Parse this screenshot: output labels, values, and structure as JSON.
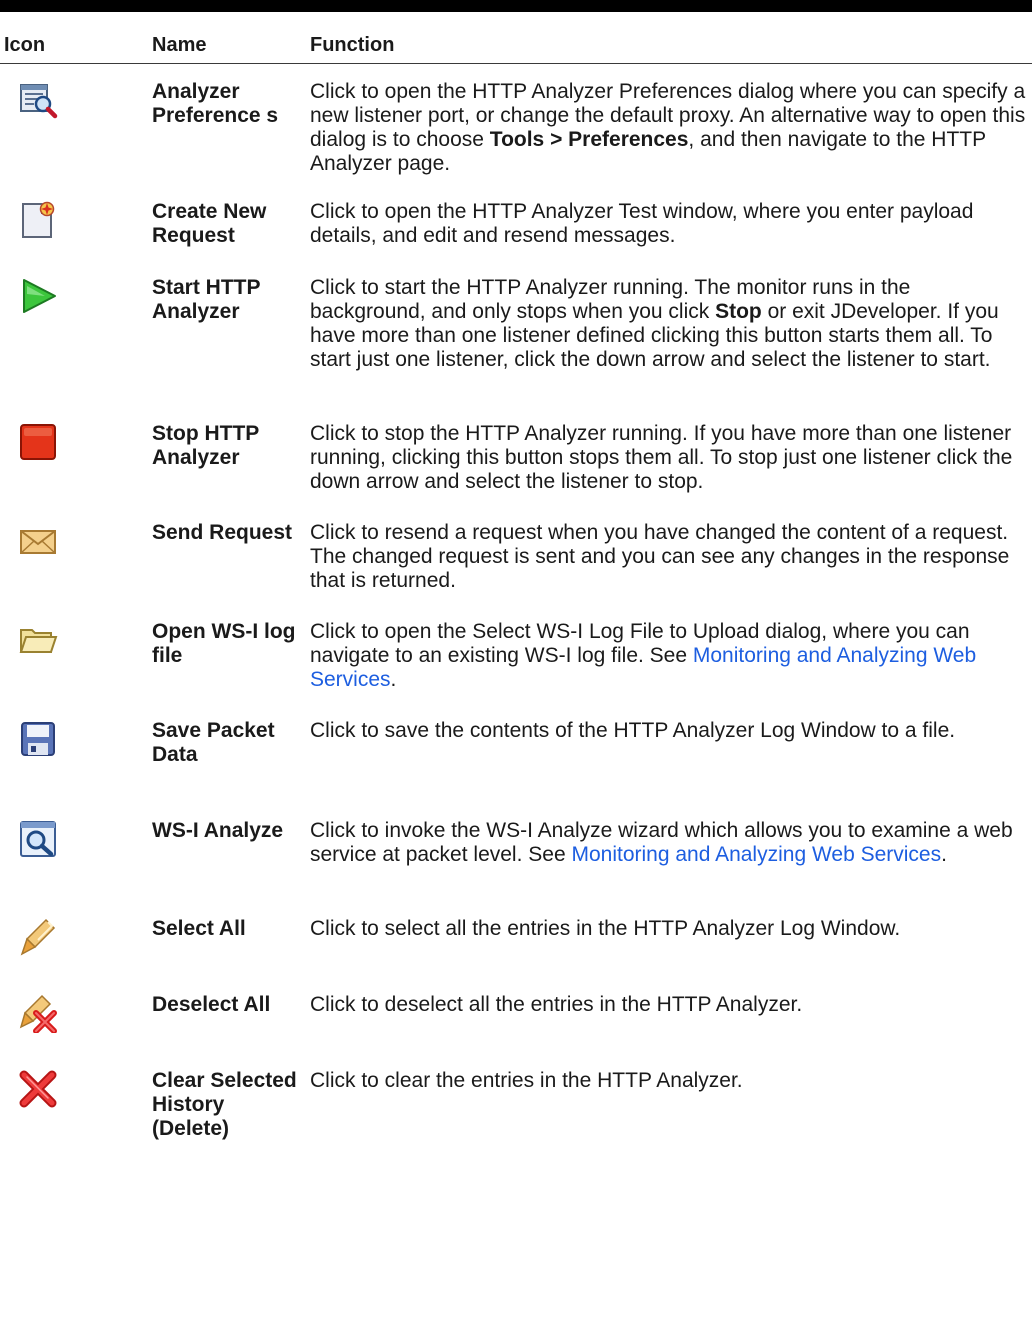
{
  "headers": {
    "icon": "Icon",
    "name": "Name",
    "function": "Function"
  },
  "rows": [
    {
      "icon": "analyzer-preferences-icon",
      "name": "Analyzer Preference s",
      "func": {
        "t1": "Click to open the HTTP Analyzer Preferences dialog where you can specify a new listener port, or change the default proxy. An alternative way to open this dialog is to choose ",
        "b1": "Tools > Preferences",
        "t2": ", and then navigate to the HTTP Analyzer page."
      }
    },
    {
      "icon": "create-new-request-icon",
      "name": "Create New Request",
      "func": {
        "t1": "Click to open the HTTP Analyzer Test window, where you enter payload details, and edit and resend messages."
      }
    },
    {
      "icon": "start-http-analyzer-icon",
      "name": "Start HTTP Analyzer",
      "func": {
        "t1": "Click to start the HTTP Analyzer running. The monitor runs in the background, and only stops when you click ",
        "b1": "Stop",
        "t2": " or exit JDeveloper. If you have more than one listener defined clicking this button starts them all. To start just one listener, click the down arrow and select the listener to start."
      }
    },
    {
      "icon": "stop-http-analyzer-icon",
      "name": "Stop HTTP Analyzer",
      "func": {
        "t1": "Click to stop the HTTP Analyzer running. If you have more than one listener running, clicking this button stops them all. To stop just one listener click the down arrow and select the listener to stop."
      }
    },
    {
      "icon": "send-request-icon",
      "name": "Send Request",
      "func": {
        "t1": "Click to resend a request when you have changed the content of a request. The changed request is sent and you can see any changes in the response that is returned."
      }
    },
    {
      "icon": "open-folder-icon",
      "name": "Open WS-I log file",
      "func": {
        "t1": "Click to open the Select WS-I Log File to Upload dialog, where you can navigate to an existing WS-I log file. See ",
        "link": "Monitoring and Analyzing Web Services",
        "t2": "."
      }
    },
    {
      "icon": "save-packet-data-icon",
      "name": "Save Packet Data",
      "func": {
        "t1": "Click to save the contents of the HTTP Analyzer Log Window to a file."
      }
    },
    {
      "icon": "ws-i-analyze-icon",
      "name": "WS-I Analyze",
      "func": {
        "t1": "Click to invoke the WS-I Analyze wizard which allows you to examine a web service at packet level. See ",
        "link": "Monitoring and Analyzing Web Services",
        "t2": "."
      }
    },
    {
      "icon": "select-all-icon",
      "name": "Select All",
      "func": {
        "t1": "Click to select all the entries in the HTTP Analyzer Log Window."
      }
    },
    {
      "icon": "deselect-all-icon",
      "name": "Deselect All",
      "func": {
        "t1": "Click to deselect all the entries in the HTTP Analyzer."
      }
    },
    {
      "icon": "clear-history-icon",
      "name": "Clear Selected History (Delete)",
      "func": {
        "t1": "Click to clear the entries in the HTTP Analyzer."
      }
    }
  ],
  "colors": {
    "link": "#1d5ee0",
    "rule": "#000000"
  }
}
